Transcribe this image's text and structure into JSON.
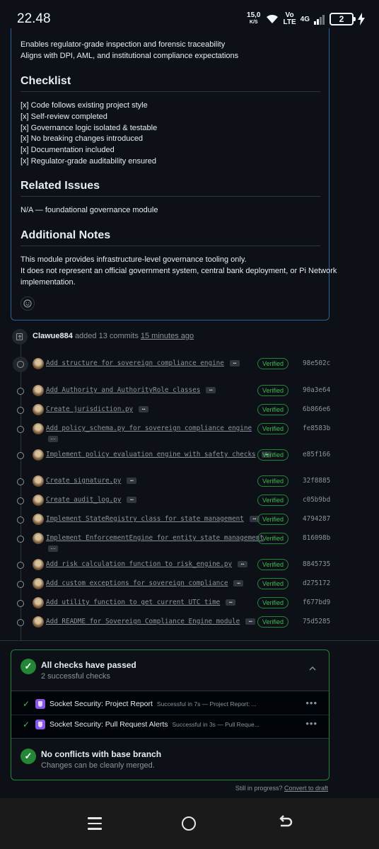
{
  "status_bar": {
    "time": "22.48",
    "net_speed": "15,0",
    "net_unit": "K/S",
    "volte": "Vo",
    "volte2": "LTE",
    "network": "4G",
    "battery": "2"
  },
  "description": {
    "lines_top": [
      "Enables regulator-grade inspection and forensic traceability",
      "Aligns with DPI, AML, and institutional compliance expectations"
    ],
    "checklist_heading": "Checklist",
    "checklist": [
      "[x] Code follows existing project style",
      "[x] Self-review completed",
      "[x] Governance logic isolated & testable",
      "[x] No breaking changes introduced",
      "[x] Documentation included",
      "[x] Regulator-grade auditability ensured"
    ],
    "related_heading": "Related Issues",
    "related_text": "N/A — foundational governance module",
    "notes_heading": "Additional Notes",
    "notes": [
      "This module provides infrastructure-level governance tooling only.",
      "It does not represent an official government system, central bank deployment, or Pi Network",
      "implementation."
    ]
  },
  "timeline": {
    "user": "Clawue884",
    "action": "added 13 commits",
    "when": "15 minutes ago",
    "verified_label": "Verified",
    "more_glyph": "…",
    "commits": [
      {
        "msg": "Add structure for sovereign compliance engine",
        "sha": "98e502c"
      },
      {
        "msg": "Add Authority and AuthorityRole classes",
        "sha": "90a3e64"
      },
      {
        "msg": "Create jurisdiction.py",
        "sha": "6b866e6"
      },
      {
        "msg": "Add policy_schema.py for sovereign compliance engine",
        "sha": "fe8583b"
      },
      {
        "msg": "Implement policy evaluation engine with safety checks",
        "sha": "e85f166"
      },
      {
        "msg": "Create signature.py",
        "sha": "32f8885"
      },
      {
        "msg": "Create audit_log.py",
        "sha": "c05b9bd"
      },
      {
        "msg": "Implement StateRegistry class for state management",
        "sha": "4794287"
      },
      {
        "msg": "Implement EnforcementEngine for entity state management",
        "sha": "816098b"
      },
      {
        "msg": "Add risk calculation function to risk_engine.py",
        "sha": "8845735"
      },
      {
        "msg": "Add custom exceptions for sovereign compliance",
        "sha": "d275172"
      },
      {
        "msg": "Add utility function to get current UTC time",
        "sha": "f677bd9"
      },
      {
        "msg": "Add README for Sovereign Compliance Engine module",
        "sha": "75d5285"
      }
    ]
  },
  "merge_box": {
    "checks_title": "All checks have passed",
    "checks_sub": "2 successful checks",
    "checks": [
      {
        "name": "Socket Security: Project Report",
        "detail": "Successful in 7s — Project Report: ..."
      },
      {
        "name": "Socket Security: Pull Request Alerts",
        "detail": "Successful in 3s — Pull Reque..."
      }
    ],
    "conflict_title": "No conflicts with base branch",
    "conflict_sub": "Changes can be cleanly merged."
  },
  "draft": {
    "prefix": "Still in progress?",
    "link": "Convert to draft"
  },
  "colors": {
    "background": "#0d1117",
    "success": "#238636",
    "border_accent": "#30609a"
  }
}
